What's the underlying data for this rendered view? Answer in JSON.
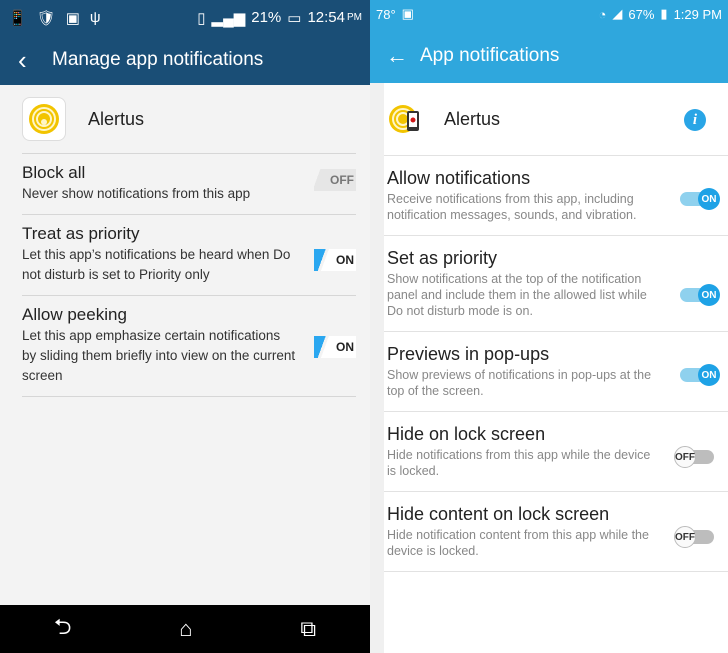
{
  "left": {
    "status": {
      "icons": [
        "📱",
        "🛡",
        "▣",
        "ψ"
      ],
      "battery": "21%",
      "time": "12:54",
      "ampm": "PM"
    },
    "title": "Manage app notifications",
    "app_name": "Alertus",
    "settings": [
      {
        "title": "Block all",
        "desc": "Never show notifications from this app",
        "toggle": "OFF"
      },
      {
        "title": "Treat as priority",
        "desc": "Let this app’s notifications be heard when Do not disturb is set to Priority only",
        "toggle": "ON"
      },
      {
        "title": "Allow peeking",
        "desc": "Let this app emphasize certain notifications by sliding them briefly into view on the current screen",
        "toggle": "ON"
      }
    ],
    "accent": "#1a4e76"
  },
  "right": {
    "status": {
      "temp": "78°",
      "battery": "67%",
      "time": "1:29 PM"
    },
    "title": "App notifications",
    "app_name": "Alertus",
    "info_label": "i",
    "settings": [
      {
        "title": "Allow notifications",
        "desc": "Receive notifications from this app, including notification messages, sounds, and vibration.",
        "toggle": "ON"
      },
      {
        "title": "Set as priority",
        "desc": "Show notifications at the top of the notification panel and include them in the allowed list while Do not disturb mode is on.",
        "toggle": "ON"
      },
      {
        "title": "Previews in pop-ups",
        "desc": "Show previews of notifications in pop-ups at the top of the screen.",
        "toggle": "ON"
      },
      {
        "title": "Hide on lock screen",
        "desc": "Hide notifications from this app while the device is locked.",
        "toggle": "OFF"
      },
      {
        "title": "Hide content on lock screen",
        "desc": "Hide notification content from this app while the device is locked.",
        "toggle": "OFF"
      }
    ],
    "accent": "#2fa7dd"
  }
}
